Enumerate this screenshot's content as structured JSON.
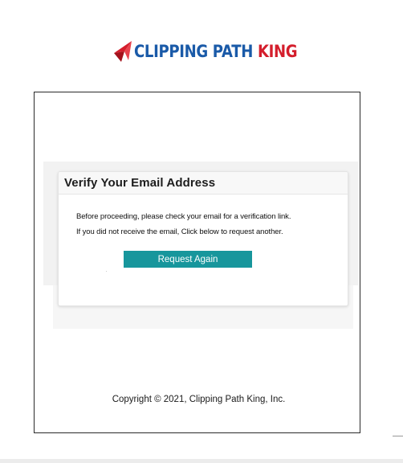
{
  "logo": {
    "text_blue": "CLIPPING PATH",
    "text_red": "KING",
    "icon": "logo-arrow-icon"
  },
  "card": {
    "title": "Verify Your Email Address",
    "message_line1": "Before proceeding, please check your email for a verification link.",
    "message_line2": "If you did not receive the email, Click below to request another.",
    "button_label": "Request Again"
  },
  "footer": {
    "copyright": "Copyright © 2021, Clipping Path King, Inc."
  },
  "colors": {
    "brand_blue": "#1a5aa8",
    "brand_red": "#d41e2c",
    "button": "#17969c"
  }
}
